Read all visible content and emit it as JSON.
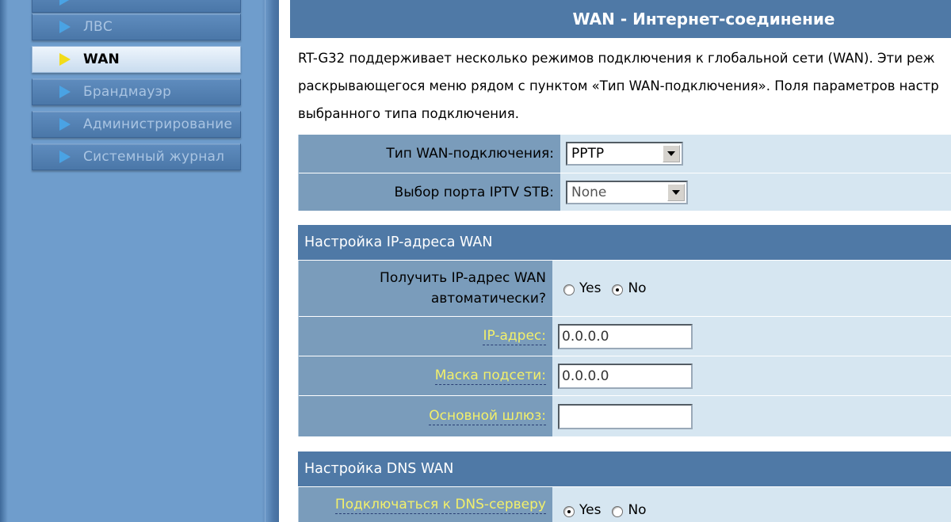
{
  "sidebar": {
    "items": [
      {
        "label": "ЛВС",
        "active": false
      },
      {
        "label": "WAN",
        "active": true
      },
      {
        "label": "Брандмауэр",
        "active": false
      },
      {
        "label": "Администрирование",
        "active": false
      },
      {
        "label": "Системный журнал",
        "active": false
      }
    ]
  },
  "header": {
    "title": "WAN - Интернет-соединение"
  },
  "description": {
    "line1": "RT-G32 поддерживает несколько режимов подключения к глобальной сети (WAN). Эти реж",
    "line2": "раскрывающегося меню рядом с пунктом «Тип WAN-подключения». Поля параметров настр",
    "line3": "выбранного типа подключения."
  },
  "connection": {
    "wan_type_label": "Тип WAN-подключения:",
    "wan_type_value": "PPTP",
    "iptv_label": "Выбор порта IPTV STB:",
    "iptv_value": "None"
  },
  "wan_ip": {
    "section_title": "Настройка IP-адреса WAN",
    "auto_label_line1": "Получить IP-адрес WAN",
    "auto_label_line2": "автоматически?",
    "yes_label": "Yes",
    "no_label": "No",
    "auto_selected": "No",
    "ip_label": "IP-адрес:",
    "ip_value": "0.0.0.0",
    "mask_label": "Маска подсети:",
    "mask_value": "0.0.0.0",
    "gateway_label": "Основной шлюз:",
    "gateway_value": ""
  },
  "wan_dns": {
    "section_title": "Настройка DNS WAN",
    "dns_label": "Подключаться к DNS-серверу",
    "yes_label": "Yes",
    "no_label": "No",
    "dns_selected": "Yes"
  },
  "colors": {
    "header_bg": "#4f79a6",
    "label_bg": "#7a9cbb",
    "value_bg": "#d6e6f1",
    "link_text": "#f3f06a",
    "active_arrow": "#f2dc1a",
    "arrow": "#4aa3e4"
  }
}
